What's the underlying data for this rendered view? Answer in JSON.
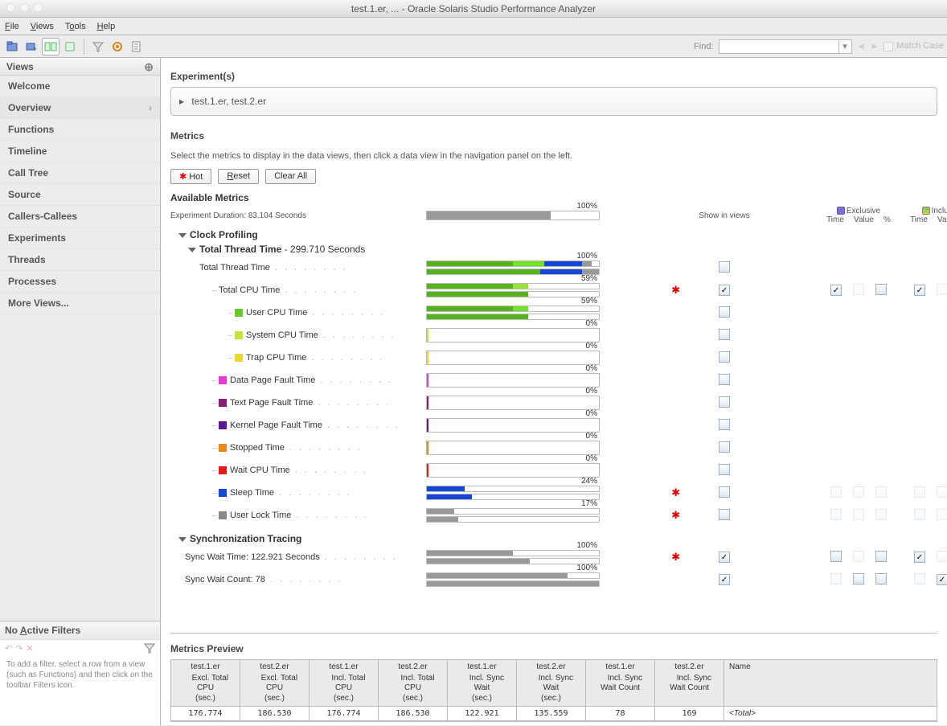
{
  "window": {
    "title": "test.1.er, ...  -  Oracle Solaris Studio Performance Analyzer"
  },
  "menu": {
    "file": "File",
    "views": "Views",
    "tools": "Tools",
    "help": "Help"
  },
  "find": {
    "label": "Find:",
    "value": "",
    "matchcase": "Match Case"
  },
  "sidebar": {
    "views_hdr": "Views",
    "items": [
      {
        "label": "Welcome"
      },
      {
        "label": "Overview",
        "selected": true
      },
      {
        "label": "Functions"
      },
      {
        "label": "Timeline"
      },
      {
        "label": "Call Tree"
      },
      {
        "label": "Source"
      },
      {
        "label": "Callers-Callees"
      },
      {
        "label": "Experiments"
      },
      {
        "label": "Threads"
      },
      {
        "label": "Processes"
      },
      {
        "label": "More Views..."
      }
    ],
    "filters_hdr": "No Active Filters",
    "filters_help": "To add a filter, select a row from a view (such as Functions) and then click on the toolbar Filters icon."
  },
  "experiments": {
    "hdr": "Experiment(s)",
    "value": "test.1.er, test.2.er"
  },
  "metrics": {
    "hdr": "Metrics",
    "help": "Select the metrics to display in the data views, then click a data view in the navigation panel on the left.",
    "btn_hot": "Hot",
    "btn_reset": "Reset",
    "btn_clear": "Clear All",
    "avail_hdr": "Available Metrics",
    "duration": "Experiment Duration: 83.104 Seconds",
    "duration_pct": "100%",
    "show_in_views": "Show in views",
    "exclusive": "Exclusive",
    "inclusive": "Inclusive",
    "time": "Time",
    "value": "Value",
    "pct": "%",
    "clock_hdr": "Clock Profiling",
    "ttt_hdr": "Total Thread Time",
    "ttt_secs": "  -  299.710 Seconds",
    "sync_hdr": "Synchronization Tracing",
    "sync_wait_time": "Sync Wait Time: 122.921 Seconds",
    "sync_wait_count": "Sync Wait Count: 78",
    "rows": [
      {
        "indent": 36,
        "name": "Total Thread Time",
        "color": "",
        "pct": "100%",
        "double": true,
        "segs1": [
          [
            0,
            50,
            "#57b21e"
          ],
          [
            50,
            68,
            "#72e02e"
          ],
          [
            68,
            90,
            "#1945d3"
          ],
          [
            90,
            96,
            "#999"
          ]
        ],
        "segs2": [
          [
            0,
            66,
            "#57b21e"
          ],
          [
            66,
            90,
            "#1945d3"
          ],
          [
            90,
            100,
            "#999"
          ]
        ],
        "hot": false,
        "show": false,
        "cbs": [
          0,
          0,
          0,
          0,
          0,
          0
        ]
      },
      {
        "indent": 52,
        "name": "Total CPU Time",
        "color": "",
        "pct": "59%",
        "double": true,
        "segs1": [
          [
            0,
            50,
            "#57b21e"
          ],
          [
            50,
            59,
            "#9be03b"
          ]
        ],
        "segs2": [
          [
            0,
            59,
            "#57b21e"
          ]
        ],
        "hot": true,
        "show": true,
        "cbs": [
          2,
          0,
          1,
          2,
          0,
          1
        ]
      },
      {
        "indent": 72,
        "sq": "#66c92a",
        "name": "User CPU Time",
        "pct": "59%",
        "double": true,
        "segs1": [
          [
            0,
            50,
            "#57b21e"
          ],
          [
            50,
            59,
            "#72e02e"
          ]
        ],
        "segs2": [
          [
            0,
            59,
            "#57b21e"
          ]
        ],
        "hot": false,
        "show": false,
        "cbs": [
          0,
          0,
          0,
          0,
          0,
          0
        ]
      },
      {
        "indent": 72,
        "sq": "#c8e23a",
        "name": "System CPU Time",
        "pct": "0%",
        "segs1": [
          [
            0,
            1,
            "#c8e23a"
          ]
        ],
        "hot": false,
        "show": false,
        "cbs": [
          0,
          0,
          0,
          0,
          0,
          0
        ]
      },
      {
        "indent": 72,
        "sq": "#e8d83a",
        "name": "Trap CPU Time",
        "pct": "0%",
        "segs1": [
          [
            0,
            1,
            "#e8d83a"
          ]
        ],
        "hot": false,
        "show": false,
        "cbs": [
          0,
          0,
          0,
          0,
          0,
          0
        ]
      },
      {
        "indent": 52,
        "sq": "#e63ad6",
        "name": "Data Page Fault Time",
        "pct": "0%",
        "segs1": [
          [
            0,
            1,
            "#e63ad6"
          ]
        ],
        "hot": false,
        "show": false,
        "cbs": [
          0,
          0,
          0,
          0,
          0,
          0
        ]
      },
      {
        "indent": 52,
        "sq": "#8a1b78",
        "name": "Text Page Fault Time",
        "pct": "0%",
        "segs1": [
          [
            0,
            1,
            "#8a1b78"
          ]
        ],
        "hot": false,
        "show": false,
        "cbs": [
          0,
          0,
          0,
          0,
          0,
          0
        ]
      },
      {
        "indent": 52,
        "sq": "#5a1895",
        "name": "Kernel Page Fault Time",
        "pct": "0%",
        "segs1": [
          [
            0,
            1,
            "#5a1895"
          ]
        ],
        "hot": false,
        "show": false,
        "cbs": [
          0,
          0,
          0,
          0,
          0,
          0
        ]
      },
      {
        "indent": 52,
        "sq": "#e68a1b",
        "name": "Stopped Time",
        "pct": "0%",
        "segs1": [
          [
            0,
            1,
            "#e68a1b"
          ]
        ],
        "hot": false,
        "show": false,
        "cbs": [
          0,
          0,
          0,
          0,
          0,
          0
        ]
      },
      {
        "indent": 52,
        "sq": "#e11b1b",
        "name": "Wait CPU Time",
        "pct": "0%",
        "segs1": [
          [
            0,
            1,
            "#e11b1b"
          ]
        ],
        "hot": false,
        "show": false,
        "cbs": [
          0,
          0,
          0,
          0,
          0,
          0
        ]
      },
      {
        "indent": 52,
        "sq": "#1945d3",
        "name": "Sleep Time",
        "pct": "24%",
        "double": true,
        "segs1": [
          [
            0,
            22,
            "#1945d3"
          ]
        ],
        "segs2": [
          [
            0,
            26,
            "#1945d3"
          ]
        ],
        "hot": true,
        "show": false,
        "cbs": [
          0,
          0,
          0,
          0,
          0,
          0
        ]
      },
      {
        "indent": 52,
        "sq": "#888",
        "name": "User Lock Time",
        "pct": "17%",
        "double": true,
        "segs1": [
          [
            0,
            16,
            "#999"
          ]
        ],
        "segs2": [
          [
            0,
            18,
            "#999"
          ]
        ],
        "hot": true,
        "show": false,
        "cbs": [
          0,
          0,
          0,
          0,
          0,
          0
        ]
      }
    ],
    "sync_rows": [
      {
        "name": "Sync Wait Time: 122.921 Seconds",
        "pct": "100%",
        "double": true,
        "segs1": [
          [
            0,
            50,
            "#999"
          ]
        ],
        "segs2": [
          [
            0,
            60,
            "#999"
          ]
        ],
        "hot": true,
        "show": true,
        "cbs": [
          1,
          0,
          1,
          2,
          0,
          1
        ]
      },
      {
        "name": "Sync Wait Count: 78",
        "pct": "100%",
        "double": true,
        "segs1": [
          [
            0,
            82,
            "#999"
          ]
        ],
        "segs2": [
          [
            0,
            130,
            "#999"
          ],
          [
            130,
            135,
            "linear-gradient(135deg,#999 25%,#fff 25%,#fff 50%,#999 50%,#999 75%,#fff 75%)"
          ]
        ],
        "hot": false,
        "show": true,
        "cbs": [
          0,
          1,
          1,
          0,
          2,
          1
        ]
      }
    ]
  },
  "preview": {
    "hdr": "Metrics Preview",
    "cols": [
      {
        "exp": "test.1.er",
        "icon": "ex",
        "m": "Excl. Total CPU",
        "u": "(sec.)",
        "v": "176.774"
      },
      {
        "exp": "test.2.er",
        "icon": "ex",
        "m": "Excl. Total CPU",
        "u": "(sec.)",
        "v": "186.530"
      },
      {
        "exp": "test.1.er",
        "icon": "in",
        "m": "Incl. Total CPU",
        "u": "(sec.)",
        "v": "176.774"
      },
      {
        "exp": "test.2.er",
        "icon": "in",
        "m": "Incl. Total CPU",
        "u": "(sec.)",
        "v": "186.530"
      },
      {
        "exp": "test.1.er",
        "icon": "in",
        "m": "Incl. Sync Wait",
        "u": "(sec.)",
        "v": "122.921"
      },
      {
        "exp": "test.2.er",
        "icon": "in",
        "m": "Incl. Sync Wait",
        "u": "(sec.)",
        "v": "135.559"
      },
      {
        "exp": "test.1.er",
        "icon": "in",
        "m": "Incl. Sync Wait Count",
        "u": "",
        "v": "78"
      },
      {
        "exp": "test.2.er",
        "icon": "in",
        "m": "Incl. Sync Wait Count",
        "u": "",
        "v": "169"
      }
    ],
    "namecol": "Name",
    "nameval": "<Total>"
  }
}
